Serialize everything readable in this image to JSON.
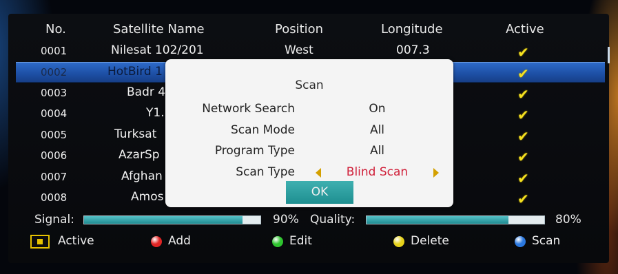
{
  "table": {
    "headers": {
      "no": "No.",
      "name": "Satellite Name",
      "position": "Position",
      "longitude": "Longitude",
      "active": "Active"
    },
    "rows": [
      {
        "no": "0001",
        "name": "Nilesat 102/201",
        "position": "West",
        "longitude": "007.3",
        "active": "✔"
      },
      {
        "no": "0002",
        "name": "HotBird 1",
        "position": "",
        "longitude": "",
        "active": "✔"
      },
      {
        "no": "0003",
        "name": "Badr 4",
        "position": "",
        "longitude": "",
        "active": "✔"
      },
      {
        "no": "0004",
        "name": "Y1.",
        "position": "",
        "longitude": "",
        "active": "✔"
      },
      {
        "no": "0005",
        "name": "Turksat",
        "position": "",
        "longitude": "",
        "active": "✔"
      },
      {
        "no": "0006",
        "name": "AzarSp",
        "position": "",
        "longitude": "",
        "active": "✔"
      },
      {
        "no": "0007",
        "name": "Afghan",
        "position": "",
        "longitude": "",
        "active": "✔"
      },
      {
        "no": "0008",
        "name": "Amos",
        "position": "",
        "longitude": "",
        "active": "✔"
      }
    ],
    "selected_index": 1
  },
  "dialog": {
    "title": "Scan",
    "fields": [
      {
        "label": "Network Search",
        "value": "On"
      },
      {
        "label": "Scan Mode",
        "value": "All"
      },
      {
        "label": "Program Type",
        "value": "All"
      },
      {
        "label": "Scan Type",
        "value": "Blind Scan"
      }
    ],
    "ok_label": "OK"
  },
  "signal": {
    "label": "Signal:",
    "percent_text": "90%",
    "level": 0.9
  },
  "quality": {
    "label": "Quality:",
    "percent_text": "80%",
    "level": 0.8
  },
  "legend": {
    "active": "Active",
    "add": "Add",
    "edit": "Edit",
    "delete": "Delete",
    "scan": "Scan"
  },
  "colors": {
    "selection": "#2e6ac8",
    "check": "#f4e020",
    "dialog_bg": "#f4f4f4",
    "scan_type_value": "#d0203a",
    "ok_button": "#2a9fa0",
    "red_key": "#e02424",
    "green_key": "#2ec42e",
    "yellow_key": "#e6d21a",
    "blue_key": "#2a78e0"
  }
}
